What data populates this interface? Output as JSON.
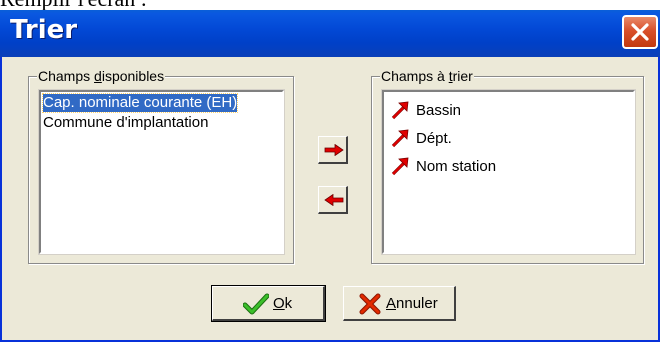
{
  "page": {
    "caption": "Remplir l'écran :"
  },
  "window": {
    "title": "Trier"
  },
  "available": {
    "label_pre": "Champs ",
    "label_accel": "d",
    "label_post": "isponibles",
    "items": [
      "Cap. nominale courante (EH)",
      "Commune d'implantation"
    ],
    "selected_index": 0
  },
  "sort": {
    "label_pre": "Champs à ",
    "label_accel": "t",
    "label_post": "rier",
    "items": [
      {
        "label": "Bassin",
        "icon": "red-arrow-up-right-icon"
      },
      {
        "label": "Dépt.",
        "icon": "red-arrow-up-right-icon"
      },
      {
        "label": "Nom station",
        "icon": "red-arrow-up-right-icon"
      }
    ]
  },
  "move_buttons": [
    {
      "icon": "arrow-right-icon",
      "color": "#e00000"
    },
    {
      "icon": "arrow-left-icon",
      "color": "#e00000"
    }
  ],
  "ok": {
    "accel": "O",
    "rest": "k",
    "icon": "check-icon",
    "color": "#2a9d1a"
  },
  "cancel": {
    "accel": "A",
    "rest": "nnuler",
    "icon": "x-icon",
    "color": "#cc2200"
  },
  "colors": {
    "titlebar": "#0349d6",
    "selection": "#316ac5",
    "face": "#ece9d8"
  }
}
